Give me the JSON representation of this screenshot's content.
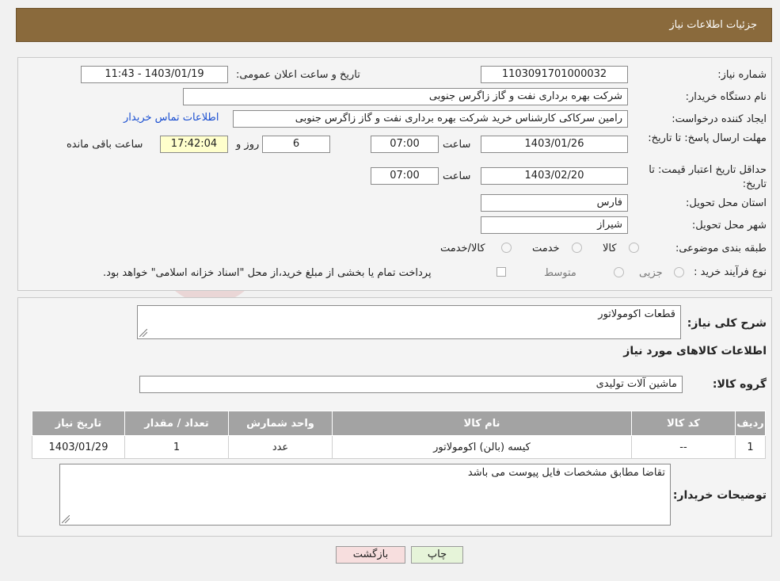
{
  "header": {
    "title": "جزئیات اطلاعات نیاز"
  },
  "fields": {
    "need_number_label": "شماره نیاز:",
    "need_number": "1103091701000032",
    "announce_label": "تاریخ و ساعت اعلان عمومی:",
    "announce_value": "1403/01/19 - 11:43",
    "buyer_org_label": "نام دستگاه خریدار:",
    "buyer_org": "شرکت بهره برداری نفت و گاز زاگرس جنوبی",
    "requester_label": "ایجاد کننده درخواست:",
    "requester": "رامین سرکاکی کارشناس خرید شرکت بهره برداری نفت و گاز زاگرس جنوبی",
    "contact_link": "اطلاعات تماس خریدار",
    "deadline_label": "مهلت ارسال پاسخ: تا تاریخ:",
    "deadline_date": "1403/01/26",
    "time_label": "ساعت",
    "deadline_time": "07:00",
    "days_value": "6",
    "days_label": "روز و",
    "remaining_time": "17:42:04",
    "remaining_label": "ساعت باقی مانده",
    "validity_label": "حداقل تاریخ اعتبار قیمت: تا تاریخ:",
    "validity_date": "1403/02/20",
    "validity_time": "07:00",
    "province_label": "استان محل تحویل:",
    "province": "فارس",
    "city_label": "شهر محل تحویل:",
    "city": "شیراز",
    "category_label": "طبقه بندی موضوعی:",
    "category_options": [
      "کالا",
      "خدمت",
      "کالا/خدمت"
    ],
    "process_label": "نوع فرآیند خرید :",
    "process_options": [
      "جزیی",
      "متوسط"
    ],
    "payment_note": "پرداخت تمام یا بخشی از مبلغ خرید،از محل \"اسناد خزانه اسلامی\" خواهد بود."
  },
  "details": {
    "summary_label": "شرح کلی نیاز:",
    "summary": "قطعات اکومولاتور",
    "goods_heading": "اطلاعات کالاهای مورد نیاز",
    "group_label": "گروه کالا:",
    "group": "ماشین آلات تولیدی",
    "table": {
      "headers": [
        "ردیف",
        "کد کالا",
        "نام کالا",
        "واحد شمارش",
        "تعداد / مقدار",
        "تاریخ نیاز"
      ],
      "rows": [
        [
          "1",
          "--",
          "کیسه (بالن) اکومولاتور",
          "عدد",
          "1",
          "1403/01/29"
        ]
      ]
    },
    "buyer_notes_label": "توضیحات خریدار:",
    "buyer_notes": "تقاضا مطابق مشخصات فایل پیوست می باشد"
  },
  "buttons": {
    "print": "چاپ",
    "back": "بازگشت"
  },
  "colors": {
    "header_bg": "#8a6a3c",
    "table_header_bg": "#a3a3a3",
    "back_button_bg": "#f7dede",
    "print_button_bg": "#e6f4d9"
  }
}
